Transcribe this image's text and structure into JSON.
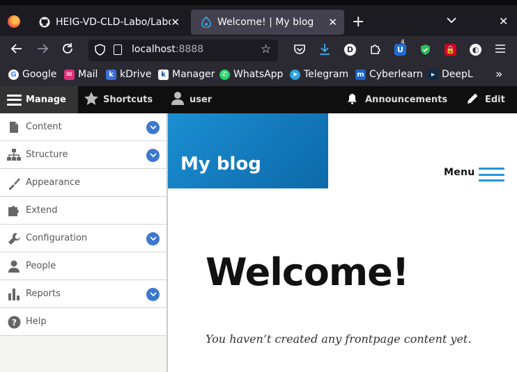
{
  "browser": {
    "tabs": [
      {
        "label": "HEIG-VD-CLD-Labo/Labo",
        "active": false
      },
      {
        "label": "Welcome! | My blog",
        "active": true
      }
    ],
    "url": "localhost:8888",
    "url_display": "localhost",
    "url_port": ":8888",
    "extension_badge": "4",
    "extension_d_label": "D",
    "bookmarks": [
      {
        "label": "Google",
        "icon": "google-icon"
      },
      {
        "label": "Mail",
        "icon": "mail-icon"
      },
      {
        "label": "kDrive",
        "icon": "kdrive-icon"
      },
      {
        "label": "Manager",
        "icon": "manager-icon"
      },
      {
        "label": "WhatsApp",
        "icon": "whatsapp-icon"
      },
      {
        "label": "Telegram",
        "icon": "telegram-icon"
      },
      {
        "label": "Cyberlearn",
        "icon": "cyberlearn-icon"
      },
      {
        "label": "DeepL",
        "icon": "deepl-icon"
      }
    ]
  },
  "toolbar": {
    "manage": "Manage",
    "shortcuts": "Shortcuts",
    "user": "user",
    "announcements": "Announcements",
    "edit": "Edit"
  },
  "sidebar": {
    "items": [
      {
        "label": "Content",
        "icon": "content-icon",
        "expandable": true
      },
      {
        "label": "Structure",
        "icon": "structure-icon",
        "expandable": true
      },
      {
        "label": "Appearance",
        "icon": "appearance-icon",
        "expandable": false
      },
      {
        "label": "Extend",
        "icon": "extend-icon",
        "expandable": false
      },
      {
        "label": "Configuration",
        "icon": "configuration-icon",
        "expandable": true
      },
      {
        "label": "People",
        "icon": "people-icon",
        "expandable": false
      },
      {
        "label": "Reports",
        "icon": "reports-icon",
        "expandable": true
      },
      {
        "label": "Help",
        "icon": "help-icon",
        "expandable": false
      }
    ]
  },
  "site": {
    "name": "My blog",
    "menu_label": "Menu",
    "welcome": "Welcome!",
    "empty_message": "You haven’t created any frontpage content yet."
  },
  "colors": {
    "brand_blue": "#1b8fd3",
    "toggle_blue": "#3c78cf",
    "toolbar_black": "#0f0f0f"
  }
}
